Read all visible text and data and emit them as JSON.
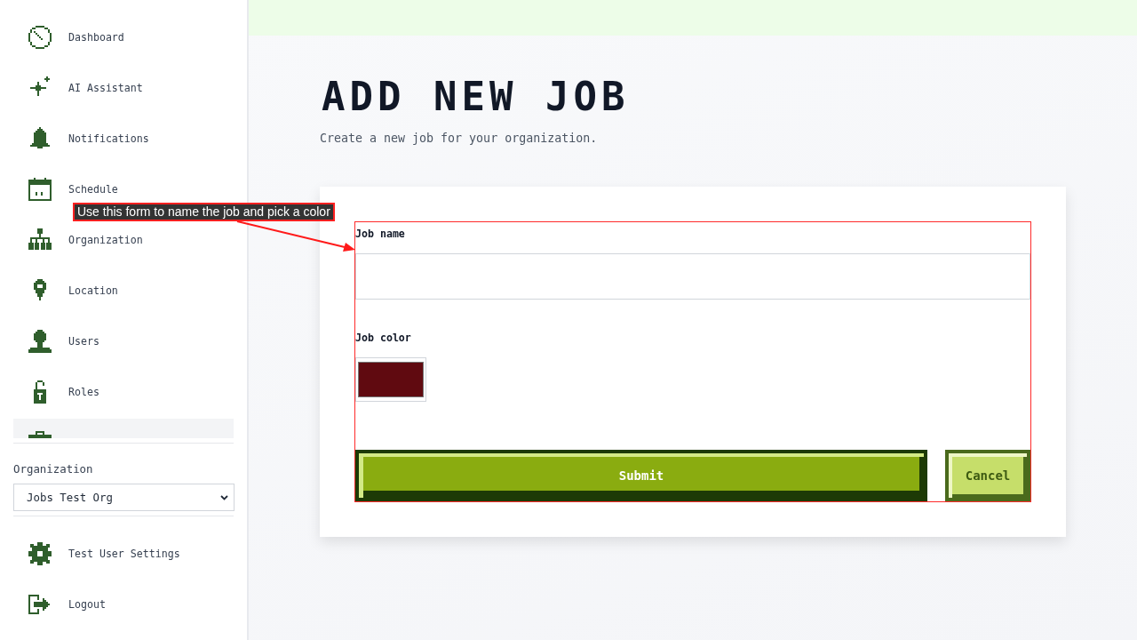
{
  "sidebar": {
    "nav_items": [
      {
        "label": "Dashboard",
        "selected": false
      },
      {
        "label": "AI Assistant",
        "selected": false
      },
      {
        "label": "Notifications",
        "selected": false
      },
      {
        "label": "Schedule",
        "selected": false
      },
      {
        "label": "Organization",
        "selected": false
      },
      {
        "label": "Location",
        "selected": false
      },
      {
        "label": "Users",
        "selected": false
      },
      {
        "label": "Roles",
        "selected": false
      },
      {
        "selected": true
      }
    ],
    "organization": {
      "label": "Organization",
      "value": "Jobs Test Org"
    },
    "account_items": [
      {
        "label": "Test User Settings"
      },
      {
        "label": "Logout"
      }
    ]
  },
  "page": {
    "title": "ADD NEW JOB",
    "subtitle": "Create a new job for your organization."
  },
  "form": {
    "fields": [
      {
        "kind": "text",
        "label": "Job name"
      },
      {
        "kind": "color",
        "label": "Job color",
        "color": "#600a10"
      }
    ],
    "buttons": [
      {
        "kind": "primary",
        "label": "Submit"
      },
      {
        "kind": "secondary",
        "label": "Cancel"
      }
    ]
  },
  "annotation": {
    "text": "Use this form to name the job and pick a color"
  }
}
